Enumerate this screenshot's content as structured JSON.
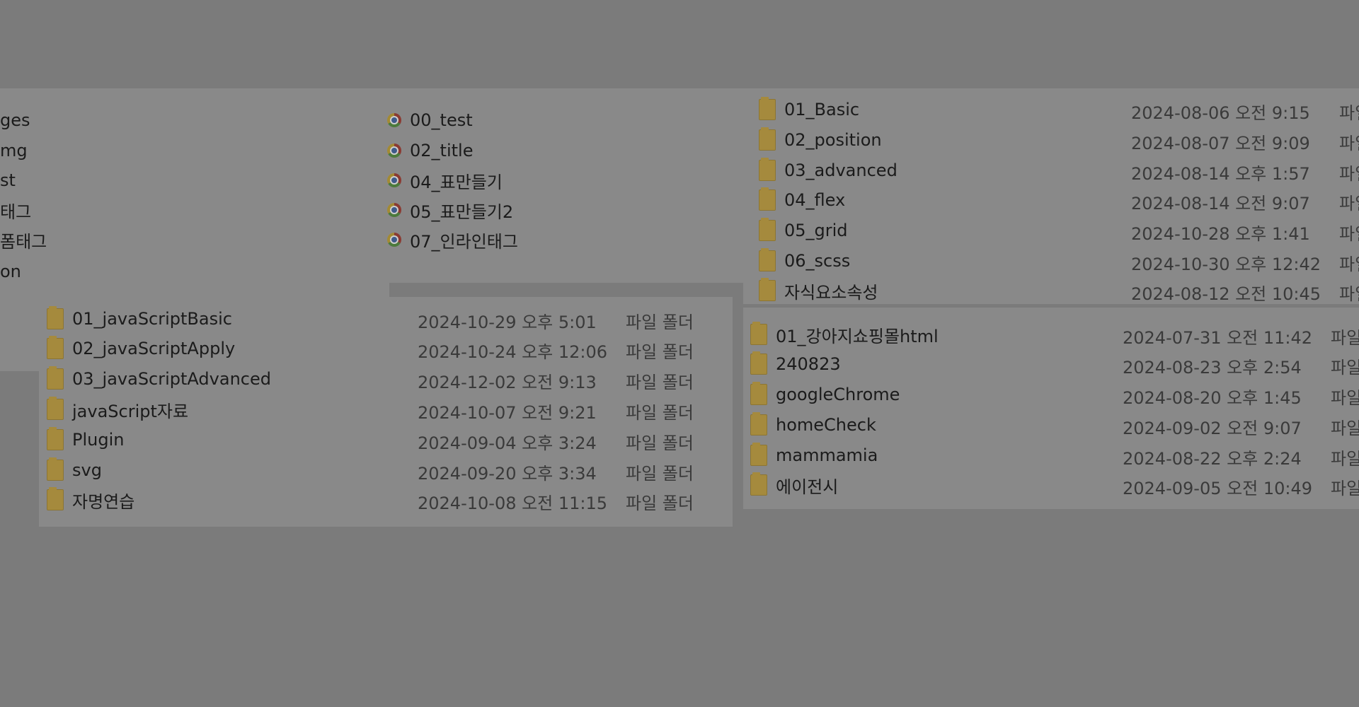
{
  "panel_a": {
    "items": [
      {
        "name": "ges"
      },
      {
        "name": "mg"
      },
      {
        "name": "st"
      },
      {
        "name": "태그"
      },
      {
        "name": "폼태그"
      },
      {
        "name": "on"
      }
    ]
  },
  "panel_b": {
    "items": [
      {
        "name": "00_test",
        "icon": "chrome-file-icon"
      },
      {
        "name": "02_title",
        "icon": "chrome-file-icon"
      },
      {
        "name": "04_표만들기",
        "icon": "chrome-file-icon"
      },
      {
        "name": "05_표만들기2",
        "icon": "chrome-file-icon"
      },
      {
        "name": "07_인라인태그",
        "icon": "chrome-file-icon"
      }
    ]
  },
  "panel_c": {
    "items": [
      {
        "name": "01_Basic",
        "date": "2024-08-06 오전 9:15",
        "type": "파일"
      },
      {
        "name": "02_position",
        "date": "2024-08-07 오전 9:09",
        "type": "파일"
      },
      {
        "name": "03_advanced",
        "date": "2024-08-14 오후 1:57",
        "type": "파일"
      },
      {
        "name": "04_flex",
        "date": "2024-08-14 오전 9:07",
        "type": "파일"
      },
      {
        "name": "05_grid",
        "date": "2024-10-28 오후 1:41",
        "type": "파일"
      },
      {
        "name": "06_scss",
        "date": "2024-10-30 오후 12:42",
        "type": "파일"
      },
      {
        "name": "자식요소속성",
        "date": "2024-08-12 오전 10:45",
        "type": "파일"
      }
    ]
  },
  "panel_d": {
    "items": [
      {
        "name": "01_javaScriptBasic",
        "date": "2024-10-29 오후 5:01",
        "type": "파일 폴더"
      },
      {
        "name": "02_javaScriptApply",
        "date": "2024-10-24 오후 12:06",
        "type": "파일 폴더"
      },
      {
        "name": "03_javaScriptAdvanced",
        "date": "2024-12-02 오전 9:13",
        "type": "파일 폴더"
      },
      {
        "name": "javaScript자료",
        "date": "2024-10-07 오전 9:21",
        "type": "파일 폴더"
      },
      {
        "name": "Plugin",
        "date": "2024-09-04 오후 3:24",
        "type": "파일 폴더"
      },
      {
        "name": "svg",
        "date": "2024-09-20 오후 3:34",
        "type": "파일 폴더"
      },
      {
        "name": "자명연습",
        "date": "2024-10-08 오전 11:15",
        "type": "파일 폴더"
      }
    ]
  },
  "panel_e": {
    "items": [
      {
        "name": "01_강아지쇼핑몰html",
        "date": "2024-07-31 오전 11:42",
        "type": "파일"
      },
      {
        "name": "240823",
        "date": "2024-08-23 오후 2:54",
        "type": "파일"
      },
      {
        "name": "googleChrome",
        "date": "2024-08-20 오후 1:45",
        "type": "파일"
      },
      {
        "name": "homeCheck",
        "date": "2024-09-02 오전 9:07",
        "type": "파일"
      },
      {
        "name": "mammamia",
        "date": "2024-08-22 오후 2:24",
        "type": "파일"
      },
      {
        "name": "에이전시",
        "date": "2024-09-05 오전 10:49",
        "type": "파일"
      }
    ]
  },
  "colors": {
    "backdrop": "#7b7b7b",
    "panel": "#898989",
    "folder": "#a58a3d",
    "text": "#1b1b1b",
    "meta_text": "#3a3a3a"
  }
}
